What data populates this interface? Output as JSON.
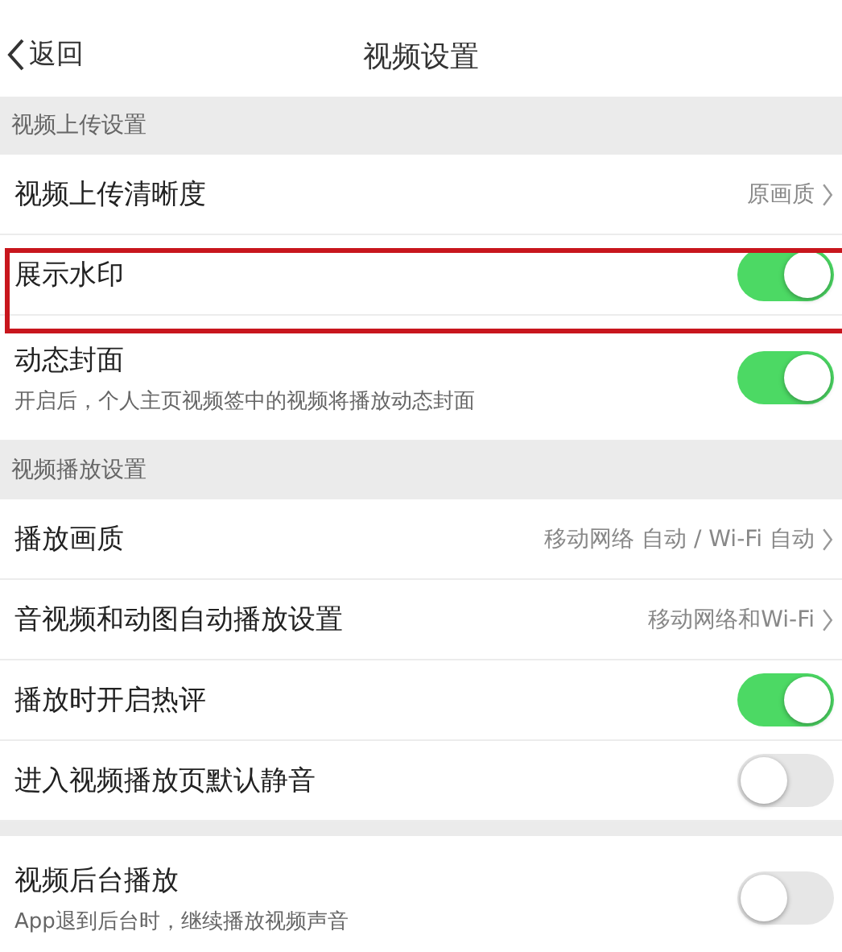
{
  "nav": {
    "back": "返回",
    "title": "视频设置"
  },
  "sections": [
    {
      "header": "视频上传设置",
      "rows": [
        {
          "kind": "link",
          "label": "视频上传清晰度",
          "value": "原画质",
          "highlighted": false
        },
        {
          "kind": "toggle",
          "label": "展示水印",
          "on": true,
          "highlighted": true
        },
        {
          "kind": "toggle",
          "label": "动态封面",
          "subtitle": "开启后，个人主页视频签中的视频将播放动态封面",
          "on": true,
          "highlighted": false
        }
      ]
    },
    {
      "header": "视频播放设置",
      "rows": [
        {
          "kind": "link",
          "label": "播放画质",
          "value": "移动网络 自动 / Wi-Fi 自动",
          "highlighted": false
        },
        {
          "kind": "link",
          "label": "音视频和动图自动播放设置",
          "value": "移动网络和Wi-Fi",
          "highlighted": false
        },
        {
          "kind": "toggle",
          "label": "播放时开启热评",
          "on": true,
          "highlighted": false
        },
        {
          "kind": "toggle",
          "label": "进入视频播放页默认静音",
          "on": false,
          "highlighted": false
        }
      ]
    },
    {
      "rows": [
        {
          "kind": "toggle",
          "label": "视频后台播放",
          "subtitle": "App退到后台时，继续播放视频声音",
          "on": false,
          "highlighted": false
        }
      ]
    }
  ]
}
